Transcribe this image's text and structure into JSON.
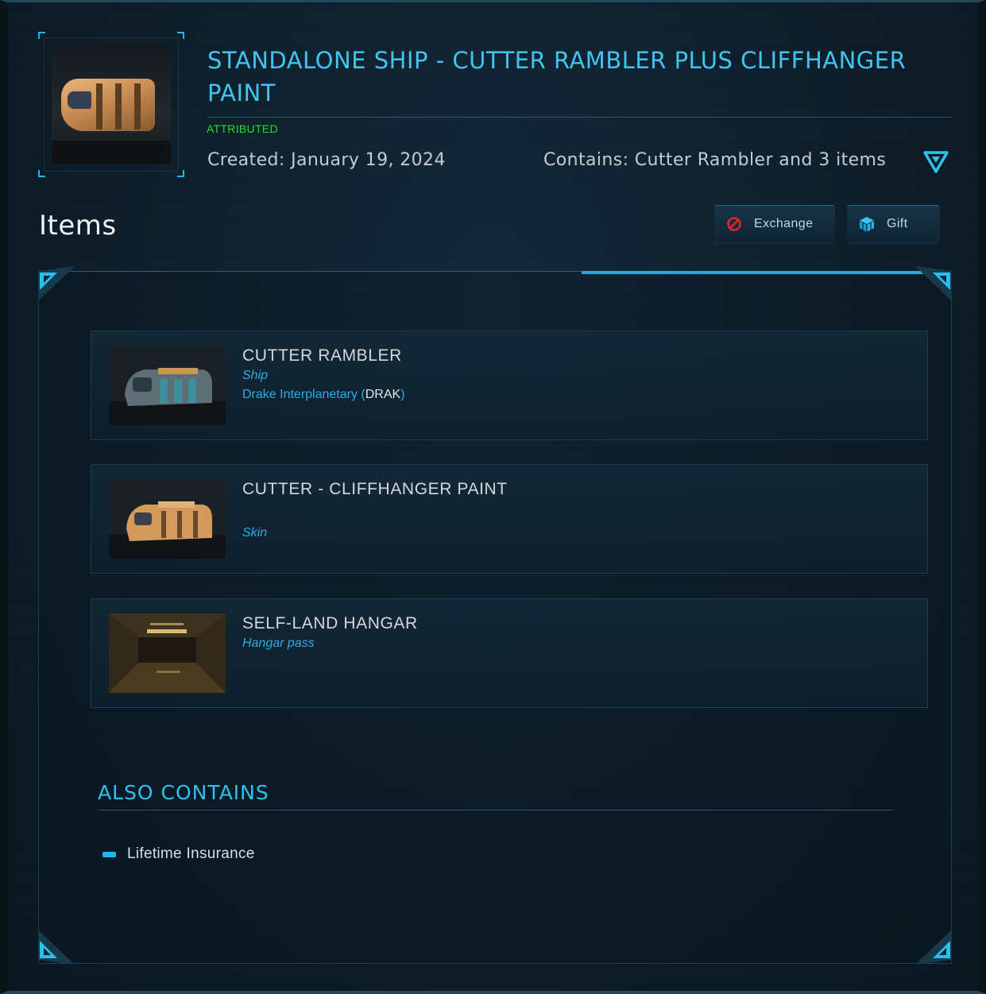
{
  "header": {
    "title": "STANDALONE SHIP - CUTTER RAMBLER PLUS CLIFFHANGER PAINT",
    "status": "ATTRIBUTED",
    "created": "Created: January 19, 2024",
    "contains": "Contains: Cutter Rambler and 3 items",
    "expand_icon": "chevron-down-triangle-icon"
  },
  "items_section": {
    "heading": "Items",
    "exchange_label": "Exchange",
    "exchange_icon": "prohibited-icon",
    "gift_label": "Gift",
    "gift_icon": "gift-box-icon"
  },
  "items": [
    {
      "name": "CUTTER RAMBLER",
      "type": "Ship",
      "manufacturer": "Drake Interplanetary",
      "manufacturer_code": "DRAK"
    },
    {
      "name": "CUTTER - CLIFFHANGER PAINT",
      "type": "Skin"
    },
    {
      "name": "SELF-LAND HANGAR",
      "type": "Hangar pass"
    }
  ],
  "also_contains": {
    "heading": "ALSO CONTAINS",
    "items": [
      "Lifetime Insurance"
    ]
  },
  "colors": {
    "accent": "#3fc6ef",
    "status_green": "#22e02a",
    "exchange_icon": "#e0242a"
  }
}
